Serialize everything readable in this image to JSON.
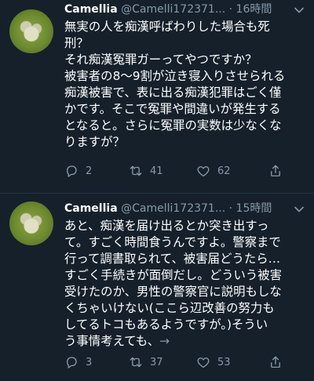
{
  "tweets": [
    {
      "name": "Camellia",
      "handle": "@Camelli172371...",
      "separator": "·",
      "time": "16時間",
      "text": "無実の人を痴漢呼ばわりした場合も死\n刑？\nそれ痴漢冤罪ガーってやつですか？\n被害者の8〜9割が泣き寝入りさせられる\n痴漢被害で、表に出る痴漢犯罪はごく僅\nかです。そこで冤罪や間違いが発生する\nとなると。さらに冤罪の実数は少なくな\nりますが？",
      "more": "",
      "replies": "2",
      "retweets": "41",
      "likes": "62"
    },
    {
      "name": "Camellia",
      "handle": "@Camelli172371...",
      "separator": "·",
      "time": "15時間",
      "text": "あと、痴漢を届け出るとか突き出すっ\nて。すごく時間食うんですよ。警察まで\n行って調書取られて、被害届どうたら…\nすごく手続きが面倒だし。どういう被害\n受けたのか、男性の警察官に説明もしな\nくちゃいけない(ここら辺改善の努力も\nしてるトコもあるようですが。)そうい\nう事情考えても、",
      "more": "→",
      "replies": "3",
      "retweets": "37",
      "likes": "53"
    }
  ],
  "icons": {
    "reply": "reply-icon",
    "retweet": "retweet-icon",
    "like": "heart-icon",
    "share": "share-icon",
    "menu": "chevron-down-icon"
  },
  "colors": {
    "background": "#15202b",
    "secondary_text": "#8899a6",
    "divider": "#253341"
  }
}
